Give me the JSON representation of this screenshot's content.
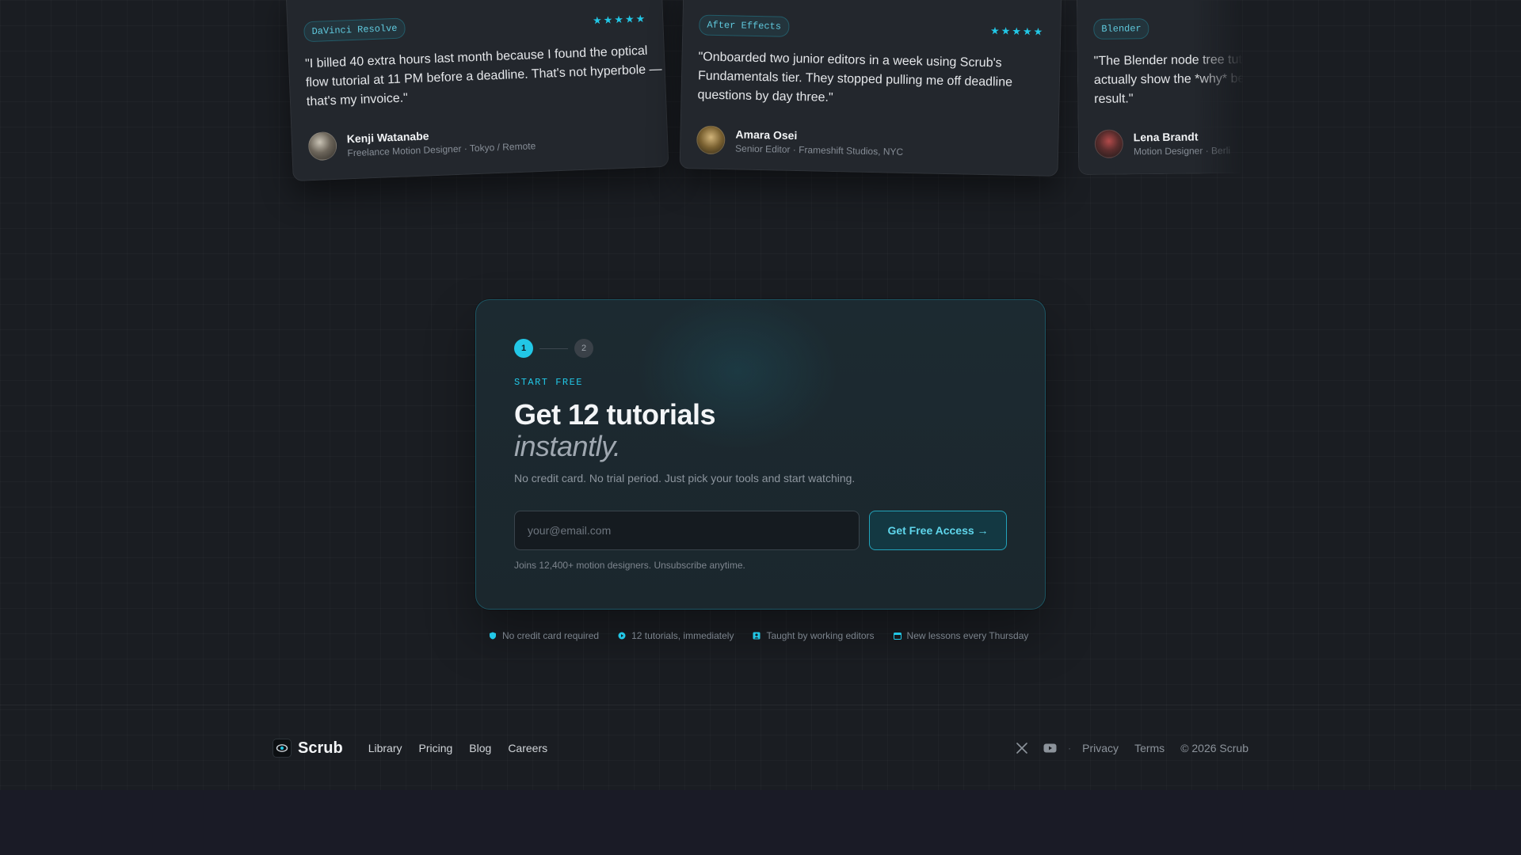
{
  "testimonials": [
    {
      "tag": "DaVinci Resolve",
      "stars": "★★★★★",
      "quote_lines": [
        "\"I billed 40 extra hours last month because I found the optical",
        "flow tutorial at 11 PM before a deadline. That's not hyperbole —",
        "that's my invoice.\""
      ],
      "name": "Kenji Watanabe",
      "role": "Freelance Motion Designer · Tokyo / Remote"
    },
    {
      "tag": "After Effects",
      "stars": "★★★★★",
      "quote_lines": [
        "\"Onboarded two junior editors in a week using Scrub's",
        "Fundamentals tier. They stopped pulling me off deadline",
        "questions by day three.\""
      ],
      "name": "Amara Osei",
      "role": "Senior Editor · Frameshift Studios, NYC"
    },
    {
      "tag": "Blender",
      "stars": "",
      "quote_lines": [
        "\"The Blender node tree tuto",
        "actually show the *why* be",
        "result.\""
      ],
      "name": "Lena Brandt",
      "role": "Motion Designer · Berli"
    }
  ],
  "signup": {
    "steps": [
      "1",
      "2"
    ],
    "eyebrow": "START FREE",
    "headline": "Get 12 tutorials",
    "headline_italic": "instantly.",
    "subtext": "No credit card. No trial period. Just pick your tools and start watching.",
    "email_placeholder": "your@email.com",
    "email_value": "",
    "cta_label": "Get Free Access →",
    "fineprint": "Joins 12,400+ motion designers. Unsubscribe anytime."
  },
  "trust": [
    {
      "icon": "shield-icon",
      "label": "No credit card required"
    },
    {
      "icon": "play-circle-icon",
      "label": "12 tutorials, immediately"
    },
    {
      "icon": "person-badge-icon",
      "label": "Taught by working editors"
    },
    {
      "icon": "calendar-icon",
      "label": "New lessons every Thursday"
    }
  ],
  "footer": {
    "brand": "Scrub",
    "nav": [
      "Library",
      "Pricing",
      "Blog",
      "Careers"
    ],
    "separator": "·",
    "legal": [
      "Privacy",
      "Terms"
    ],
    "copyright": "© 2026 Scrub"
  },
  "colors": {
    "accent": "#22c7e6",
    "background": "#1a1d22",
    "card": "#23272d"
  }
}
